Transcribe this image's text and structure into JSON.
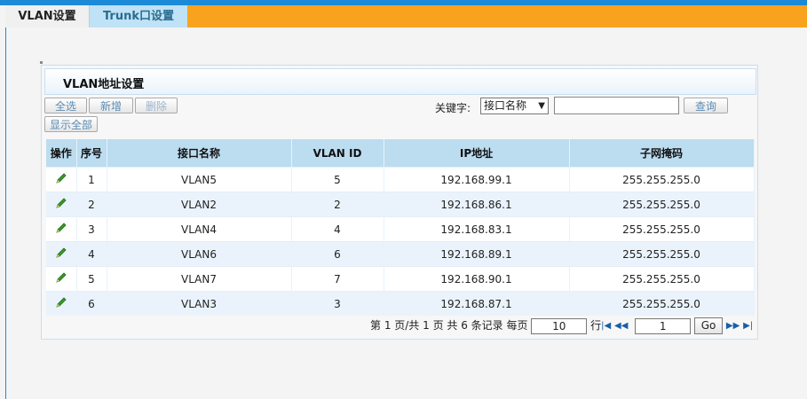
{
  "tabs": [
    {
      "label": "VLAN设置"
    },
    {
      "label": "Trunk口设置"
    }
  ],
  "panel": {
    "title": "VLAN地址设置"
  },
  "toolbar": {
    "select_all": "全选",
    "add": "新增",
    "delete": "删除",
    "show_all": "显示全部",
    "keyword_label": "关键字:",
    "keyword_option": "接口名称",
    "search": "查询"
  },
  "table": {
    "headers": [
      "操作",
      "序号",
      "接口名称",
      "VLAN ID",
      "IP地址",
      "子网掩码"
    ],
    "rows": [
      {
        "index": "1",
        "name": "VLAN5",
        "vid": "5",
        "ip": "192.168.99.1",
        "mask": "255.255.255.0"
      },
      {
        "index": "2",
        "name": "VLAN2",
        "vid": "2",
        "ip": "192.168.86.1",
        "mask": "255.255.255.0"
      },
      {
        "index": "3",
        "name": "VLAN4",
        "vid": "4",
        "ip": "192.168.83.1",
        "mask": "255.255.255.0"
      },
      {
        "index": "4",
        "name": "VLAN6",
        "vid": "6",
        "ip": "192.168.89.1",
        "mask": "255.255.255.0"
      },
      {
        "index": "5",
        "name": "VLAN7",
        "vid": "7",
        "ip": "192.168.90.1",
        "mask": "255.255.255.0"
      },
      {
        "index": "6",
        "name": "VLAN3",
        "vid": "3",
        "ip": "192.168.87.1",
        "mask": "255.255.255.0"
      }
    ]
  },
  "pager": {
    "summary": "第 1 页/共 1 页 共 6 条记录 每页",
    "per_page": "10",
    "row_unit": "行",
    "page": "1",
    "go": "Go"
  }
}
